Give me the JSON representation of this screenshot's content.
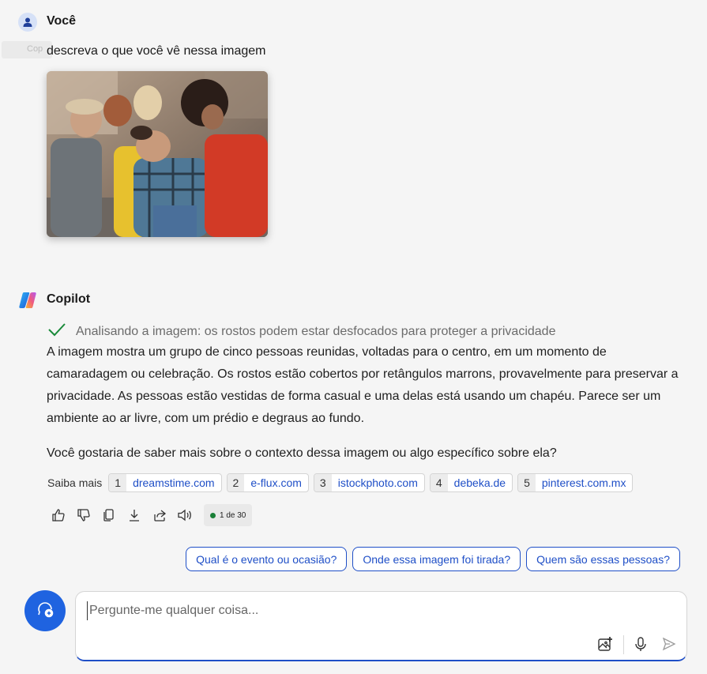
{
  "user": {
    "name": "Você",
    "ghost_label": "Cop",
    "message": "descreva o que você vê nessa imagem"
  },
  "copilot": {
    "name": "Copilot",
    "analysis": "Analisando a imagem: os rostos podem estar desfocados para proteger a privacidade",
    "answer_p1": "A imagem mostra um grupo de cinco pessoas reunidas, voltadas para o centro, em um momento de camaradagem ou celebração. Os rostos estão cobertos por retângulos marrons, provavelmente para preservar a privacidade. As pessoas estão vestidas de forma casual e uma delas está usando um chapéu. Parece ser um ambiente ao ar livre, com um prédio e degraus ao fundo.",
    "answer_p2": "Você gostaria de saber mais sobre o contexto dessa imagem ou algo específico sobre ela?",
    "learn_more_label": "Saiba mais",
    "sources": [
      {
        "num": "1",
        "name": "dreamstime.com"
      },
      {
        "num": "2",
        "name": "e-flux.com"
      },
      {
        "num": "3",
        "name": "istockphoto.com"
      },
      {
        "num": "4",
        "name": "debeka.de"
      },
      {
        "num": "5",
        "name": "pinterest.com.mx"
      }
    ],
    "counter": "1 de 30"
  },
  "suggestions": [
    "Qual é o evento ou ocasião?",
    "Onde essa imagem foi tirada?",
    "Quem são essas pessoas?"
  ],
  "composer": {
    "placeholder": "Pergunte-me qualquer coisa..."
  },
  "icons": {
    "user_avatar": "person-icon",
    "copilot_logo": "copilot-logo-icon",
    "check": "check-icon",
    "like": "thumbs-up-icon",
    "dislike": "thumbs-down-icon",
    "copy": "copy-icon",
    "download": "download-icon",
    "share": "share-icon",
    "speaker": "speaker-icon",
    "new_chat": "new-chat-icon",
    "add_image": "add-image-icon",
    "mic": "microphone-icon",
    "send": "send-icon"
  },
  "colors": {
    "accent": "#1f4fc7",
    "new_chat_bg": "#1f63e0",
    "check": "#1a8a3a",
    "status_dot": "#1a7f37"
  }
}
